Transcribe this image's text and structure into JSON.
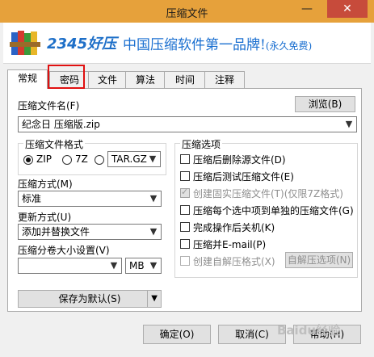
{
  "window": {
    "title": "压缩文件",
    "minimize_glyph": "—",
    "close_glyph": "✕"
  },
  "banner": {
    "brand": "2345好压",
    "slogan": "中国压缩软件第一品牌!",
    "slogan_sub": "(永久免费)",
    "logo_icon": "books-archive-icon"
  },
  "tabs": [
    "常规",
    "密码",
    "文件",
    "算法",
    "时间",
    "注释"
  ],
  "highlight": {
    "color": "#e01010"
  },
  "general": {
    "filename_label": "压缩文件名(F)",
    "browse_label": "浏览(B)",
    "filename_value": "纪念日  压缩版.zip",
    "format_group_title": "压缩文件格式",
    "format_zip": "ZIP",
    "format_7z": "7Z",
    "format_targz_value": "TAR.GZ",
    "method_label": "压缩方式(M)",
    "method_value": "标准",
    "update_label": "更新方式(U)",
    "update_value": "添加并替换文件",
    "split_label": "压缩分卷大小设置(V)",
    "split_value": "",
    "split_unit": "MB",
    "save_default_label": "保存为默认(S)",
    "options_group_title": "压缩选项",
    "options": [
      {
        "label": "压缩后删除源文件(D)",
        "checked": false,
        "disabled": false
      },
      {
        "label": "压缩后测试压缩文件(E)",
        "checked": false,
        "disabled": false
      },
      {
        "label": "创建固实压缩文件(T)(仅限7Z格式)",
        "checked": true,
        "disabled": true
      },
      {
        "label": "压缩每个选中项到单独的压缩文件(G)",
        "checked": false,
        "disabled": false
      },
      {
        "label": "完成操作后关机(K)",
        "checked": false,
        "disabled": false
      },
      {
        "label": "压缩并E-mail(P)",
        "checked": false,
        "disabled": false
      },
      {
        "label": "创建自解压格式(X)",
        "checked": false,
        "disabled": true
      }
    ],
    "sfx_options_label": "自解压选项(N)"
  },
  "footer": {
    "ok_label": "确定(O)",
    "cancel_label": "取消(C)",
    "help_label": "帮助(H)",
    "watermark": "Baidu经验"
  }
}
